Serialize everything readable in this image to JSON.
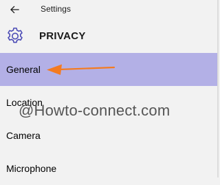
{
  "titlebar": {
    "back_icon": "back-arrow-icon",
    "title": "Settings"
  },
  "header": {
    "icon": "gear-icon",
    "title": "PRIVACY"
  },
  "nav": {
    "items": [
      {
        "label": "General",
        "selected": true
      },
      {
        "label": "Location",
        "selected": false
      },
      {
        "label": "Camera",
        "selected": false
      },
      {
        "label": "Microphone",
        "selected": false
      }
    ]
  },
  "annotation": {
    "arrow_icon": "orange-arrow-icon",
    "arrow_color": "#f47b20"
  },
  "colors": {
    "background": "#f2f2f2",
    "selected_bg": "#b3b0e6",
    "accent_gear": "#4a4ab5"
  },
  "watermark": "@Howto-connect.com"
}
